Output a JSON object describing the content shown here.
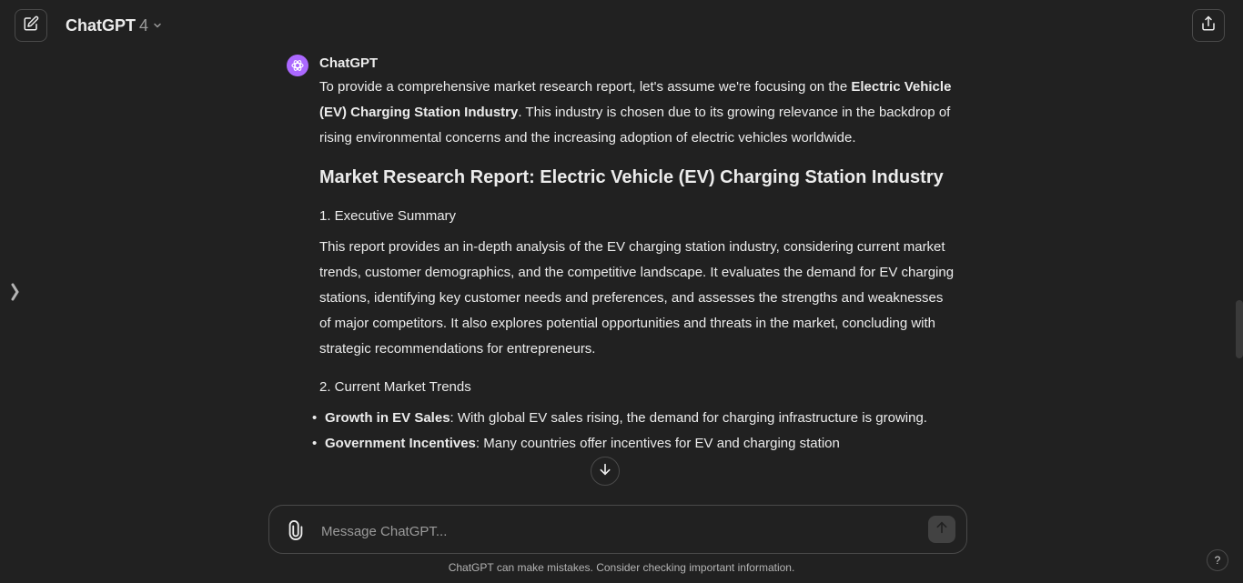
{
  "header": {
    "model_name": "ChatGPT",
    "model_version": "4"
  },
  "message": {
    "speaker": "ChatGPT",
    "intro_text_1": "To provide a comprehensive market research report, let's assume we're focusing on the ",
    "intro_bold": "Electric Vehicle (EV) Charging Station Industry",
    "intro_text_2": ". This industry is chosen due to its growing relevance in the backdrop of rising environmental concerns and the increasing adoption of electric vehicles worldwide.",
    "heading": "Market Research Report: Electric Vehicle (EV) Charging Station Industry",
    "section1_title": "1. Executive Summary",
    "section1_body": "This report provides an in-depth analysis of the EV charging station industry, considering current market trends, customer demographics, and the competitive landscape. It evaluates the demand for EV charging stations, identifying key customer needs and preferences, and assesses the strengths and weaknesses of major competitors. It also explores potential opportunities and threats in the market, concluding with strategic recommendations for entrepreneurs.",
    "section2_title": "2. Current Market Trends",
    "bullets": [
      {
        "bold": "Growth in EV Sales",
        "text": ": With global EV sales rising, the demand for charging infrastructure is growing."
      },
      {
        "bold": "Government Incentives",
        "text": ": Many countries offer incentives for EV and charging station"
      }
    ]
  },
  "composer": {
    "placeholder": "Message ChatGPT..."
  },
  "footer": {
    "disclaimer": "ChatGPT can make mistakes. Consider checking important information.",
    "help_label": "?"
  },
  "icons": {
    "new_chat": "edit-icon",
    "share": "share-icon",
    "model_dropdown": "chevron-down-icon",
    "sidebar": "sidebar-toggle-icon",
    "avatar": "openai-logo-icon",
    "scroll_down": "arrow-down-icon",
    "attach": "paperclip-icon",
    "send": "arrow-up-icon"
  },
  "colors": {
    "background": "#212121",
    "text": "#ececec",
    "avatar_bg": "#ab68ff",
    "border": "#4a4a4a"
  }
}
